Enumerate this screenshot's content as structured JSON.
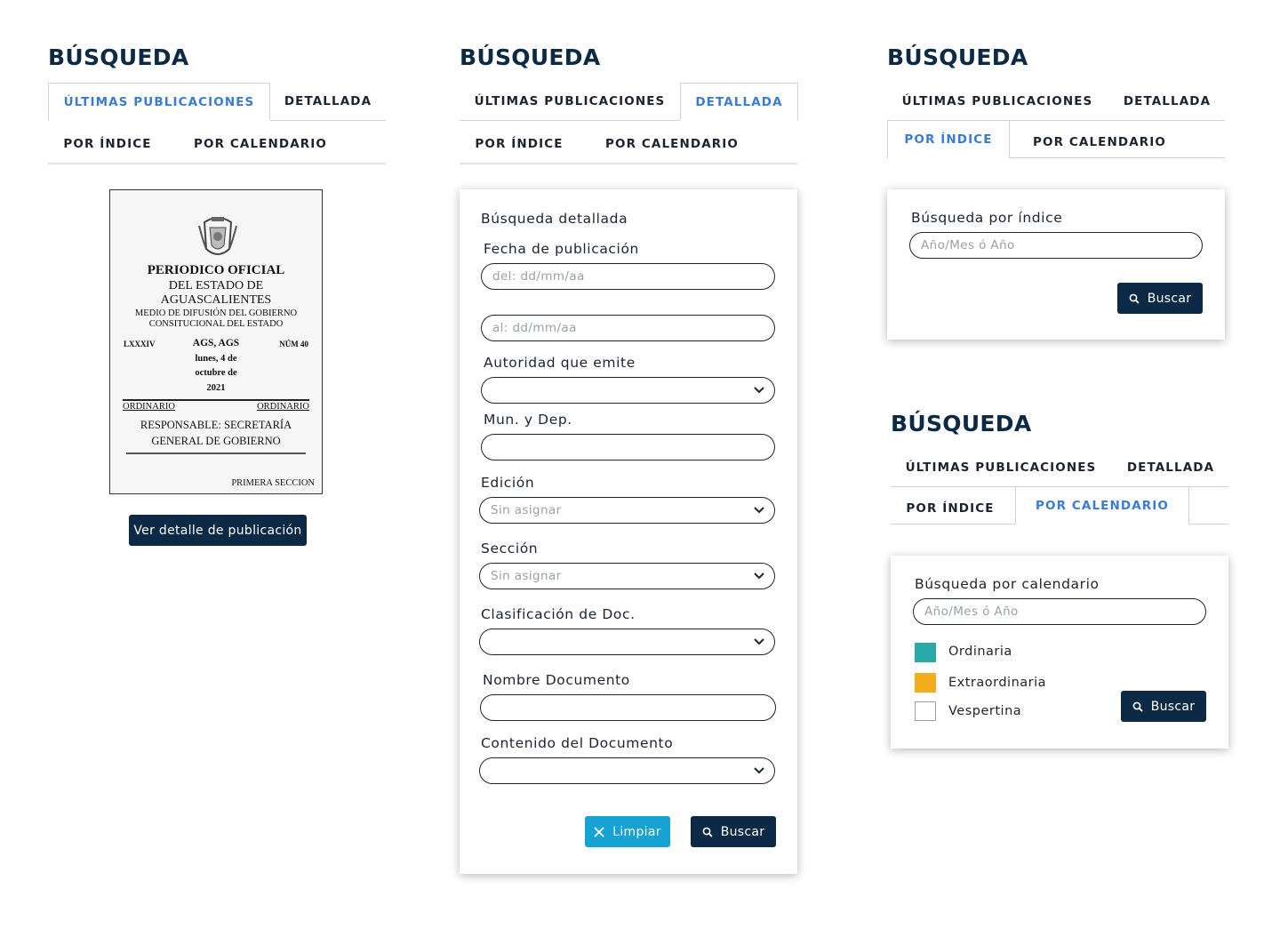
{
  "panels": [
    {
      "title": "BÚSQUEDA",
      "tabs": [
        "ÚLTIMAS PUBLICACIONES",
        "DETALLADA"
      ],
      "subtabs": [
        "POR ÍNDICE",
        "POR CALENDARIO"
      ]
    },
    {
      "title": "BÚSQUEDA",
      "tabs": [
        "ÚLTIMAS PUBLICACIONES",
        "DETALLADA"
      ],
      "subtabs": [
        "POR ÍNDICE",
        "POR CALENDARIO"
      ]
    },
    {
      "title": "BÚSQUEDA",
      "tabs": [
        "ÚLTIMAS PUBLICACIONES",
        "DETALLADA"
      ],
      "subtabs": [
        "POR ÍNDICE",
        "POR CALENDARIO"
      ]
    },
    {
      "title": "BÚSQUEDA",
      "tabs": [
        "ÚLTIMAS PUBLICACIONES",
        "DETALLADA"
      ],
      "subtabs": [
        "POR ÍNDICE",
        "POR CALENDARIO"
      ]
    }
  ],
  "cover": {
    "line1": "PERIODICO OFICIAL",
    "line2": "DEL ESTADO DE",
    "line3": "AGUASCALIENTES",
    "line4": "MEDIO DE DIFUSIÓN DEL GOBIERNO",
    "line5": "CONSITUCIONAL DEL ESTADO",
    "tomo": "LXXXIV",
    "place": "AGS, AGS",
    "date1": "lunes, 4 de",
    "date2": "octubre de",
    "date3": "2021",
    "num": "NÚM 40",
    "type_left": "ORDINARIO",
    "type_right": "ORDINARIO",
    "resp1": "RESPONSABLE: SECRETARÍA",
    "resp2": "GENERAL DE GOBIERNO",
    "section": "PRIMERA SECCION"
  },
  "detail_button": "Ver detalle de publicación",
  "detailed": {
    "heading": "Búsqueda detallada",
    "fecha_label": "Fecha de publicación",
    "from_placeholder": "del: dd/mm/aa",
    "to_placeholder": "al: dd/mm/aa",
    "autoridad_label": "Autoridad que emite",
    "mun_label": "Mun. y Dep.",
    "edicion_label": "Edición",
    "edicion_value": "Sin asignar",
    "seccion_label": "Sección",
    "seccion_value": "Sin asignar",
    "clasif_label": "Clasificación de Doc.",
    "nombre_label": "Nombre Documento",
    "contenido_label": "Contenido del Documento",
    "clear_button": "Limpiar",
    "search_button": "Buscar"
  },
  "index_search": {
    "heading": "Búsqueda por índice",
    "placeholder": "Año/Mes ó Año",
    "search_button": "Buscar"
  },
  "calendar_search": {
    "heading": "Búsqueda por calendario",
    "placeholder": "Año/Mes ó Año",
    "legend": [
      {
        "label": "Ordinaria",
        "color": "#2aaaa8"
      },
      {
        "label": "Extraordinaria",
        "color": "#f3ac1c"
      },
      {
        "label": "Vespertina",
        "color": "#ffffff"
      }
    ],
    "search_button": "Buscar"
  },
  "colors": {
    "navy": "#0c2a45",
    "active_tab": "#3a7bd5",
    "clear": "#17a2d4"
  }
}
